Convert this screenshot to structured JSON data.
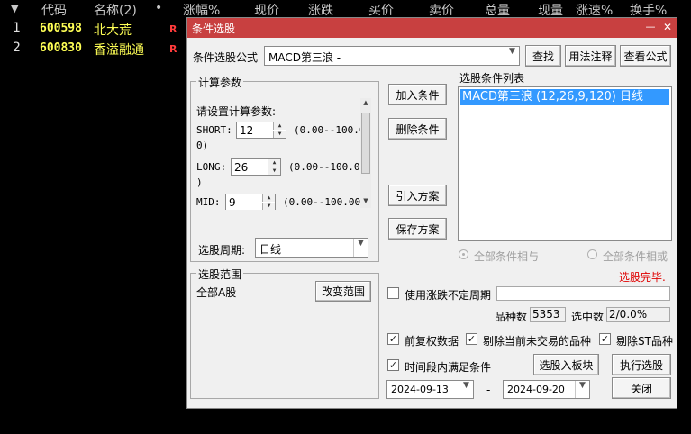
{
  "background": {
    "header": {
      "sort_icon": "▼",
      "code": "代码",
      "name": "名称(2)",
      "dot": "•",
      "change_pct": "涨幅%",
      "price": "现价",
      "change": "涨跌",
      "bid": "买价",
      "ask": "卖价",
      "volume": "总量",
      "current_vol": "现量",
      "speed": "涨速%",
      "turnover": "换手%"
    },
    "rows": [
      {
        "idx": "1",
        "code": "600598",
        "name": "北大荒",
        "flag": "R"
      },
      {
        "idx": "2",
        "code": "600830",
        "name": "香溢融通",
        "flag": "R"
      }
    ]
  },
  "dialog": {
    "title": "条件选股",
    "minimize": "—",
    "close": "✕",
    "formula_label": "条件选股公式",
    "formula_value": "MACD第三浪   -",
    "find_button": "查找",
    "usage_button": "用法注释",
    "view_formula_button": "查看公式",
    "params": {
      "group_title": "计算参数",
      "prompt": "请设置计算参数:",
      "short_label": "SHORT:",
      "short_value": "12",
      "short_range_a": "(0.00--100.0",
      "short_range_b": "0)",
      "long_label": "LONG:",
      "long_value": "26",
      "long_range_a": "(0.00--100.00",
      "long_range_b": ")",
      "mid_label": "MID:",
      "mid_value": "9",
      "mid_range": "(0.00--100.00)"
    },
    "period_label": "选股周期:",
    "period_value": "日线",
    "add_condition": "加入条件",
    "delete_condition": "删除条件",
    "import_plan": "引入方案",
    "save_plan": "保存方案",
    "condition_list_label": "选股条件列表",
    "conditions": [
      "MACD第三浪 (12,26,9,120) 日线"
    ],
    "logic_and": "全部条件相与",
    "logic_or": "全部条件相或",
    "status": "选股完毕.",
    "range_group_title": "选股范围",
    "range_value": "全部A股",
    "change_range": "改变范围",
    "use_variable_period": "使用涨跌不定周期",
    "variety_count_label": "品种数",
    "variety_count": "5353",
    "selected_label": "选中数",
    "selected_value": "2/0.0%",
    "fq_data": "前复权数据",
    "exclude_untraded": "剔除当前未交易的品种",
    "exclude_st": "剔除ST品种",
    "time_range": "时间段内满足条件",
    "to_block": "选股入板块",
    "execute": "执行选股",
    "date_from": "2024-09-13",
    "date_sep": "-",
    "date_to": "2024-09-20",
    "close_button": "关闭"
  }
}
